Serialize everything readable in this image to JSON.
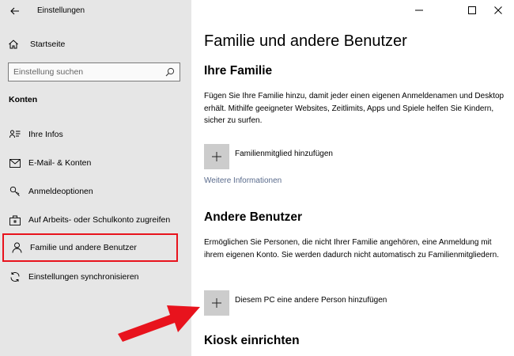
{
  "window": {
    "app_title": "Einstellungen"
  },
  "sidebar": {
    "home_label": "Startseite",
    "search_placeholder": "Einstellung suchen",
    "section_heading": "Konten",
    "items": [
      {
        "label": "Ihre Infos",
        "icon": "person-card-icon"
      },
      {
        "label": "E-Mail- & Konten",
        "icon": "mail-icon"
      },
      {
        "label": "Anmeldeoptionen",
        "icon": "key-icon"
      },
      {
        "label": "Auf Arbeits- oder Schulkonto zugreifen",
        "icon": "briefcase-icon"
      },
      {
        "label": "Familie und andere Benutzer",
        "icon": "person-icon",
        "selected": true
      },
      {
        "label": "Einstellungen synchronisieren",
        "icon": "sync-icon"
      }
    ]
  },
  "main": {
    "page_title": "Familie und andere Benutzer",
    "family": {
      "heading": "Ihre Familie",
      "description": "Fügen Sie Ihre Familie hinzu, damit jeder einen eigenen Anmeldenamen und Desktop erhält. Mithilfe geeigneter Websites, Zeitlimits, Apps und Spiele helfen Sie Kindern, sicher zu surfen.",
      "add_label": "Familienmitglied hinzufügen",
      "more_info_link": "Weitere Informationen"
    },
    "others": {
      "heading": "Andere Benutzer",
      "description": "Ermöglichen Sie Personen, die nicht Ihrer Familie angehören, eine Anmeldung mit ihrem eigenen Konto. Sie werden dadurch nicht automatisch zu Familienmitgliedern.",
      "add_label": "Diesem PC eine andere Person hinzufügen"
    },
    "kiosk": {
      "heading": "Kiosk einrichten"
    }
  },
  "colors": {
    "sidebar_bg": "#e6e6e6",
    "highlight_border": "#e8131d",
    "arrow": "#e8131d",
    "link": "#5a6b8c",
    "tile": "#cccccc"
  }
}
